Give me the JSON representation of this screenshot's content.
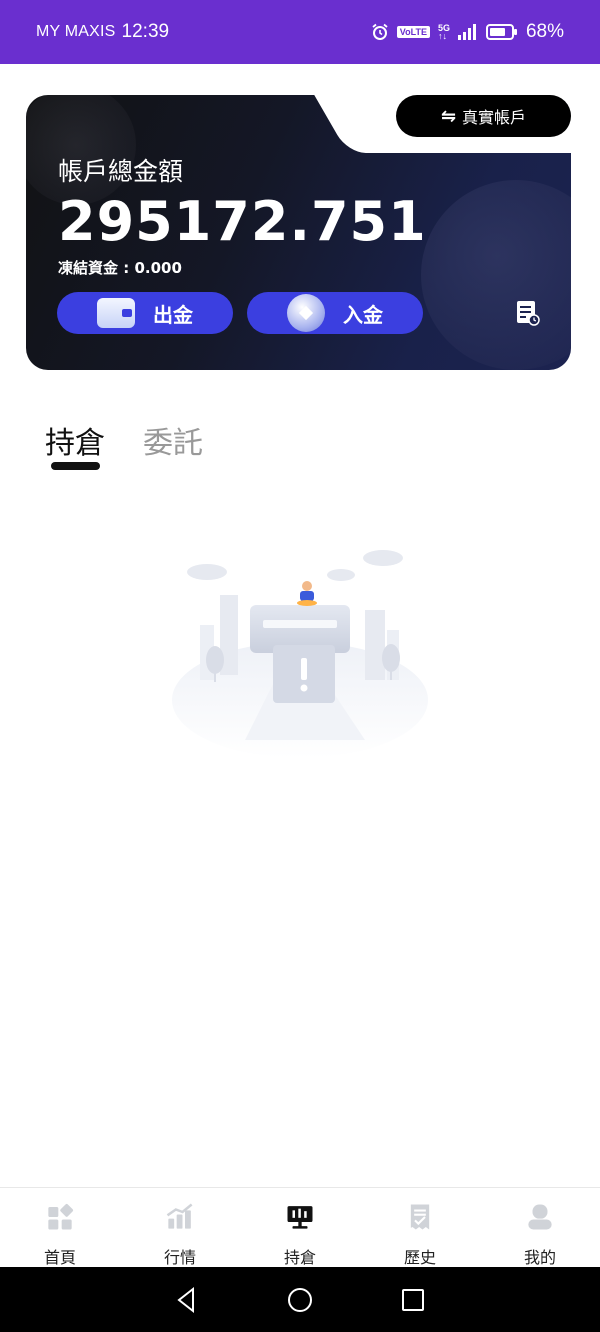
{
  "status_bar": {
    "carrier": "MY MAXIS",
    "time": "12:39",
    "volte": "VoLTE",
    "network_top": "5G",
    "network_bottom": "↑↓",
    "battery": "68%"
  },
  "account": {
    "switch_label": "真實帳戶",
    "switch_icon": "⇋",
    "balance_label": "帳戶總金額",
    "balance_value": "295172.751",
    "frozen_label": "凍結資金 : 0.000",
    "withdraw_label": "出金",
    "deposit_label": "入金"
  },
  "tabs": [
    {
      "label": "持倉",
      "active": true
    },
    {
      "label": "委託",
      "active": false
    }
  ],
  "bottom_nav": [
    {
      "label": "首頁",
      "icon": "home-grid-icon",
      "active": false
    },
    {
      "label": "行情",
      "icon": "market-chart-icon",
      "active": false
    },
    {
      "label": "持倉",
      "icon": "holdings-monitor-icon",
      "active": true
    },
    {
      "label": "歷史",
      "icon": "history-receipt-icon",
      "active": false
    },
    {
      "label": "我的",
      "icon": "profile-person-icon",
      "active": false
    }
  ],
  "colors": {
    "status_bar": "#6a2fcf",
    "action_button": "#3b3fe0",
    "card_dark": "#111213",
    "card_navy": "#1c2350",
    "tab_active": "#111111",
    "tab_inactive": "#999999",
    "nav_inactive_icon": "#d0d3d8",
    "nav_active_icon": "#111111"
  }
}
